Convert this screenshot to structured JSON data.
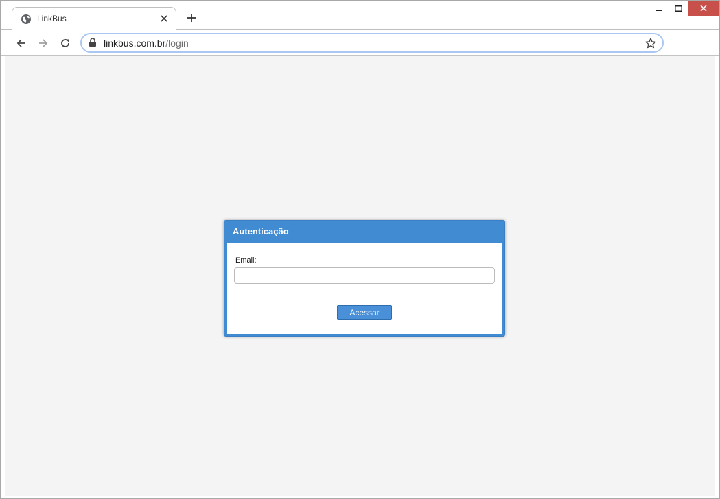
{
  "browser": {
    "tab_title": "LinkBus",
    "url_host": "linkbus.com.br",
    "url_path": "/login"
  },
  "login": {
    "title": "Autenticação",
    "email_label": "Email:",
    "email_value": "",
    "submit_label": "Acessar"
  },
  "colors": {
    "dialog_blue": "#418bd3",
    "button_blue": "#4a90d8",
    "page_bg": "#f4f4f4",
    "close_red": "#c7504a"
  },
  "icons": [
    "globe-icon",
    "close-icon",
    "plus-icon",
    "minimize-icon",
    "maximize-icon",
    "back-arrow-icon",
    "forward-arrow-icon",
    "reload-icon",
    "lock-icon",
    "star-icon"
  ]
}
